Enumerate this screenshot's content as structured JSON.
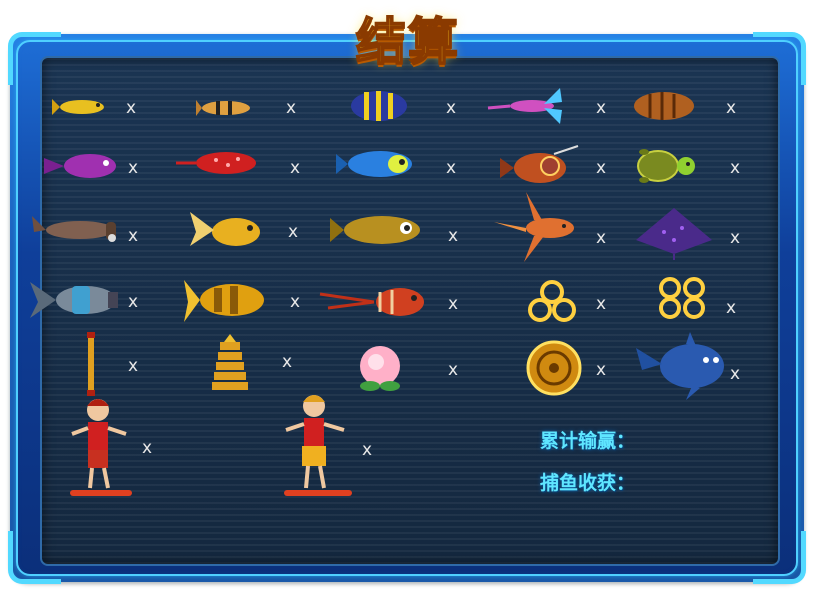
{
  "title": "结算",
  "multiplier_mark": "x",
  "summary": {
    "total_win_label": "累计输赢：",
    "catch_label": "捕鱼收获："
  },
  "items": [
    {
      "name": "small-yellow-fish"
    },
    {
      "name": "striped-minnow"
    },
    {
      "name": "blue-yellow-angelfish"
    },
    {
      "name": "pink-winged-fish"
    },
    {
      "name": "brown-striped-fish"
    },
    {
      "name": "purple-fish"
    },
    {
      "name": "red-spotted-fish"
    },
    {
      "name": "blue-puffer-fish"
    },
    {
      "name": "lantern-anglerfish"
    },
    {
      "name": "sea-turtle"
    },
    {
      "name": "hammerhead-shark"
    },
    {
      "name": "goldfish"
    },
    {
      "name": "grouper"
    },
    {
      "name": "orange-swordfish"
    },
    {
      "name": "purple-manta-ray"
    },
    {
      "name": "mecha-shark"
    },
    {
      "name": "golden-mecha-fish"
    },
    {
      "name": "red-lionfish"
    },
    {
      "name": "triple-gold-coins"
    },
    {
      "name": "quad-gold-coins"
    },
    {
      "name": "golden-staff"
    },
    {
      "name": "golden-pagoda"
    },
    {
      "name": "immortal-peach"
    },
    {
      "name": "golden-wheel"
    },
    {
      "name": "blue-whale"
    },
    {
      "name": "monkey-king-red"
    },
    {
      "name": "monkey-king-gold"
    }
  ]
}
